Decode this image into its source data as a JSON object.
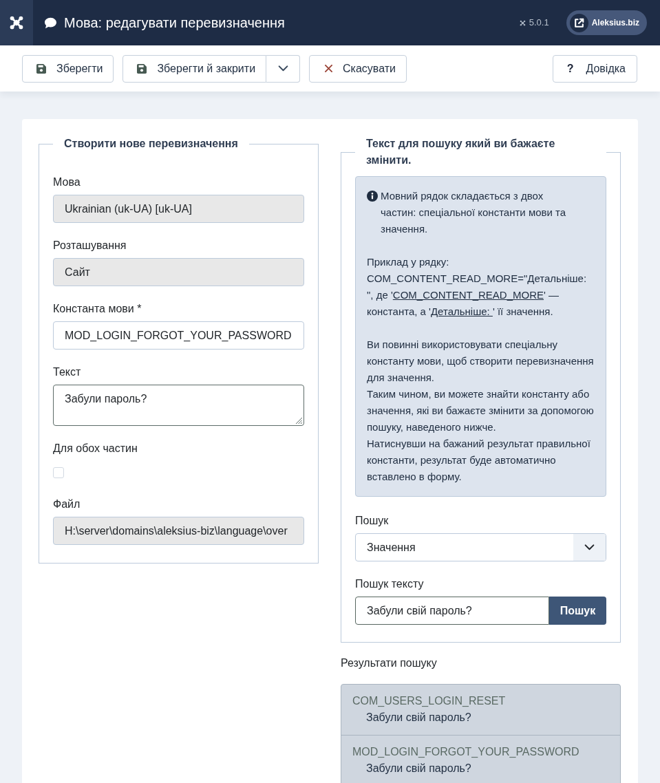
{
  "header": {
    "title": "Мова: редагувати перевизначення",
    "version": "5.0.1",
    "site_link": "Aleksius.biz"
  },
  "toolbar": {
    "buttons": [
      {
        "kind": "save",
        "label": "Зберегти",
        "dropdown": false
      },
      {
        "kind": "save",
        "label": "Зберегти й закрити",
        "dropdown": true
      },
      {
        "kind": "cancel",
        "label": "Скасувати",
        "dropdown": false
      }
    ],
    "help_button": {
      "icon": "?",
      "label": "Довідка"
    }
  },
  "override_form": {
    "legend": "Створити нове перевизначення",
    "fields": [
      {
        "kind": "input",
        "label": "Мова",
        "value": "Ukrainian (uk-UA) [uk-UA]",
        "readonly": true
      },
      {
        "kind": "input",
        "label": "Розташування",
        "value": "Сайт",
        "readonly": true
      },
      {
        "kind": "input",
        "label": "Константа мови *",
        "value": "MOD_LOGIN_FORGOT_YOUR_PASSWORD",
        "readonly": false
      },
      {
        "kind": "textarea",
        "label": "Текст",
        "value": "Забули пароль?",
        "readonly": false
      },
      {
        "kind": "checkbox",
        "label": "Для обох частин",
        "checked": false
      },
      {
        "kind": "input",
        "label": "Файл",
        "value": "H:\\server\\domains\\aleksius-biz\\language\\over",
        "readonly": true
      }
    ]
  },
  "search_panel": {
    "legend": "Текст для пошуку який ви бажаєте змінити.",
    "info": {
      "intro": "Мовний рядок складається з двох частин: спеціальної константи мови та значення.",
      "example": [
        {
          "text": "Приклад у рядку: COM_CONTENT_READ_MORE=\"Детальніше: \", де '",
          "underlined": false
        },
        {
          "text": "COM_CONTENT_READ_MORE",
          "underlined": true
        },
        {
          "text": "' — константа, а '",
          "underlined": false
        },
        {
          "text": "Детальніше: ",
          "underlined": true
        },
        {
          "text": "' її значення.",
          "underlined": false
        }
      ],
      "notes": [
        "Ви повинні використовувати спеціальну константу мови, щоб створити перевизначення для значення.",
        "Таким чином, ви можете знайти константу або значення, які ви бажаєте змінити за допомогою пошуку, наведеного нижче.",
        "Натиснувши на бажаний результат правильної константи, результат буде автоматично вставлено в форму."
      ]
    },
    "search_by": {
      "label": "Пошук",
      "value": "Значення"
    },
    "search_text": {
      "label": "Пошук тексту",
      "value": "Забули свій пароль?",
      "button": "Пошук"
    }
  },
  "results": {
    "title": "Результати пошуку",
    "items": [
      {
        "constant": "COM_USERS_LOGIN_RESET",
        "value": "Забули свій пароль?"
      },
      {
        "constant": "MOD_LOGIN_FORGOT_YOUR_PASSWORD",
        "value": "Забули свій пароль?"
      }
    ]
  }
}
